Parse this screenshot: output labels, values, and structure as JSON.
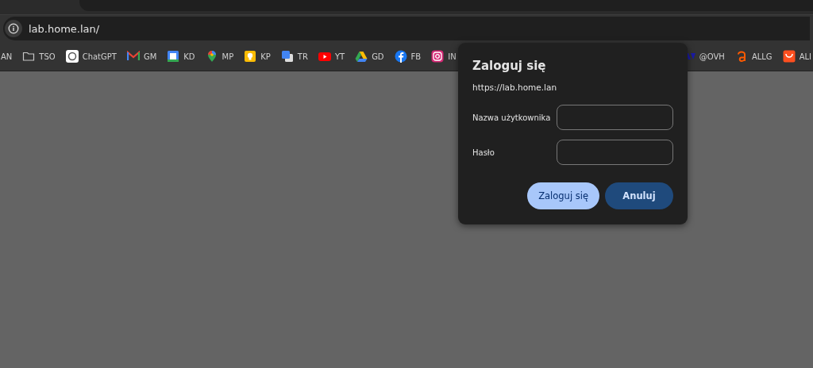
{
  "address_bar": {
    "url": "lab.home.lan/"
  },
  "bookmarks": [
    {
      "label": "AN",
      "kind": "none"
    },
    {
      "label": "TSO",
      "kind": "folder"
    },
    {
      "label": "ChatGPT",
      "kind": "chatgpt"
    },
    {
      "label": "GM",
      "kind": "mail"
    },
    {
      "label": "KD",
      "kind": "calendar"
    },
    {
      "label": "MP",
      "kind": "pin"
    },
    {
      "label": "KP",
      "kind": "bulb"
    },
    {
      "label": "TR",
      "kind": "translate"
    },
    {
      "label": "YT",
      "kind": "video"
    },
    {
      "label": "GD",
      "kind": "drive"
    },
    {
      "label": "FB",
      "kind": "fb"
    },
    {
      "label": "IN",
      "kind": "camera"
    }
  ],
  "bookmarks_right": [
    {
      "label": "@OVH",
      "kind": "ovh"
    },
    {
      "label": "ALLG",
      "kind": "a"
    },
    {
      "label": "ALI",
      "kind": "bag"
    }
  ],
  "login_dialog": {
    "title": "Zaloguj się",
    "origin": "https://lab.home.lan",
    "fields": [
      {
        "label": "Nazwa użytkownika"
      },
      {
        "label": "Hasło"
      }
    ],
    "buttons": [
      {
        "label": "Zaloguj się",
        "kind": "primary"
      },
      {
        "label": "Anuluj",
        "kind": "secondary"
      }
    ]
  }
}
